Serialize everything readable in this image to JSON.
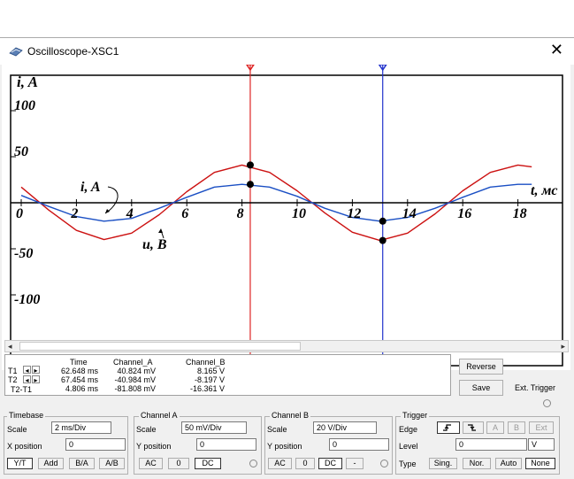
{
  "window": {
    "title": "Oscilloscope-XSC1",
    "close_symbol": "✕"
  },
  "plot": {
    "y_axis_label": "i, A",
    "x_axis_label": "t, мс",
    "x_ticks": [
      "0",
      "2",
      "4",
      "6",
      "8",
      "10",
      "12",
      "14",
      "16",
      "18"
    ],
    "y_ticks": [
      "100",
      "50",
      "-50",
      "-100"
    ],
    "annotation_current": "i, A",
    "annotation_voltage": "u, B",
    "colors": {
      "channel_a": "#cc1111",
      "channel_b": "#1a4fc4",
      "cursor_t1": "#dd2222",
      "cursor_t2": "#2233cc"
    }
  },
  "chart_data": {
    "type": "line",
    "title": "",
    "xlabel": "t, мс",
    "ylabel": "i, A",
    "xlim": [
      0,
      19
    ],
    "ylim": [
      -100,
      100
    ],
    "series": [
      {
        "name": "",
        "color": "#cc1111",
        "x": [
          0,
          1,
          2,
          3,
          4,
          5,
          6,
          7,
          8,
          9,
          10,
          11,
          12,
          13,
          14,
          15,
          16,
          17,
          18,
          18.5
        ],
        "y": [
          17,
          -8,
          -30,
          -40,
          -33,
          -13,
          12,
          33,
          41,
          33,
          13,
          -11,
          -32,
          -41,
          -33,
          -12,
          13,
          33,
          41,
          39
        ]
      },
      {
        "name": "",
        "color": "#1a4fc4",
        "x": [
          0,
          1,
          2,
          3,
          4,
          5,
          6,
          7,
          8,
          9,
          10,
          11,
          12,
          13,
          14,
          15,
          16,
          17,
          18,
          18.5
        ],
        "y": [
          8,
          -4,
          -15,
          -20,
          -17,
          -6,
          6,
          17,
          20,
          17,
          7,
          -6,
          -16,
          -20,
          -16,
          -6,
          6,
          17,
          20,
          20
        ]
      }
    ],
    "cursors": {
      "t1_ms": 8.3,
      "t2_ms": 13.1
    },
    "markers": [
      {
        "x": 8.3,
        "y": 41
      },
      {
        "x": 8.3,
        "y": 20
      },
      {
        "x": 13.1,
        "y": -20
      },
      {
        "x": 13.1,
        "y": -41
      }
    ]
  },
  "readout": {
    "headers": {
      "time": "Time",
      "channel_a": "Channel_A",
      "channel_b": "Channel_B"
    },
    "rows": [
      {
        "label": "T1",
        "time": "62.648 ms",
        "channel_a": "40.824 mV",
        "channel_b": "8.165 V"
      },
      {
        "label": "T2",
        "time": "67.454 ms",
        "channel_a": "-40.984 mV",
        "channel_b": "-8.197 V"
      },
      {
        "label": "T2-T1",
        "time": "4.806 ms",
        "channel_a": "-81.808 mV",
        "channel_b": "-16.361 V"
      }
    ]
  },
  "buttons": {
    "reverse": "Reverse",
    "save": "Save",
    "ext_trigger": "Ext. Trigger"
  },
  "timebase": {
    "title": "Timebase",
    "scale_label": "Scale",
    "scale_value": "2 ms/Div",
    "xpos_label": "X position",
    "xpos_value": "0",
    "modes": [
      "Y/T",
      "Add",
      "B/A",
      "A/B"
    ]
  },
  "channel_a": {
    "title": "Channel A",
    "scale_label": "Scale",
    "scale_value": "50 mV/Div",
    "ypos_label": "Y position",
    "ypos_value": "0",
    "coupling": [
      "AC",
      "0",
      "DC"
    ]
  },
  "channel_b": {
    "title": "Channel B",
    "scale_label": "Scale",
    "scale_value": "20  V/Div",
    "ypos_label": "Y position",
    "ypos_value": "0",
    "coupling": [
      "AC",
      "0",
      "DC",
      "-"
    ]
  },
  "trigger": {
    "title": "Trigger",
    "edge_label": "Edge",
    "sources": [
      "A",
      "B",
      "Ext"
    ],
    "level_label": "Level",
    "level_value": "0",
    "level_unit": "V",
    "type_label": "Type",
    "types": [
      "Sing.",
      "Nor.",
      "Auto",
      "None"
    ]
  }
}
